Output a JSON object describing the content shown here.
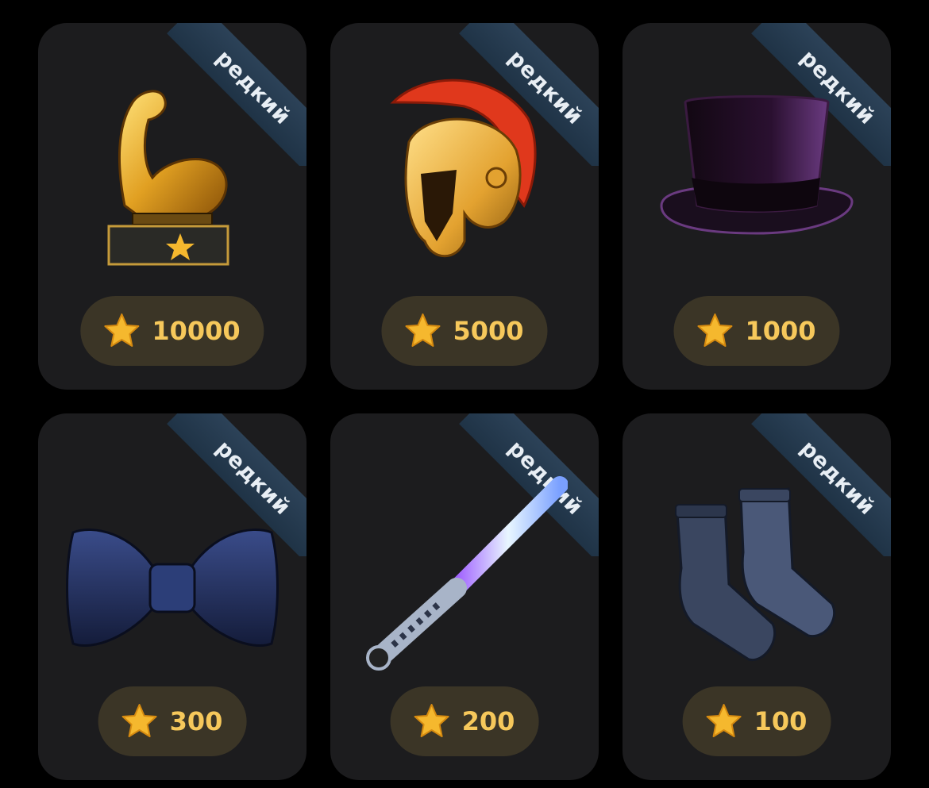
{
  "gifts": [
    {
      "badge": "редкий",
      "price": "10000",
      "icon": "flexed-biceps-trophy-icon"
    },
    {
      "badge": "редкий",
      "price": "5000",
      "icon": "spartan-helmet-icon"
    },
    {
      "badge": "редкий",
      "price": "1000",
      "icon": "top-hat-icon"
    },
    {
      "badge": "редкий",
      "price": "300",
      "icon": "bow-tie-icon"
    },
    {
      "badge": "редкий",
      "price": "200",
      "icon": "lightsaber-icon"
    },
    {
      "badge": "редкий",
      "price": "100",
      "icon": "socks-icon"
    }
  ],
  "colors": {
    "card_bg": "#1c1c1e",
    "ribbon": "#2c4258",
    "price_pill": "#3b3526",
    "price_text": "#f6c85b",
    "star": "#f5b82e"
  }
}
